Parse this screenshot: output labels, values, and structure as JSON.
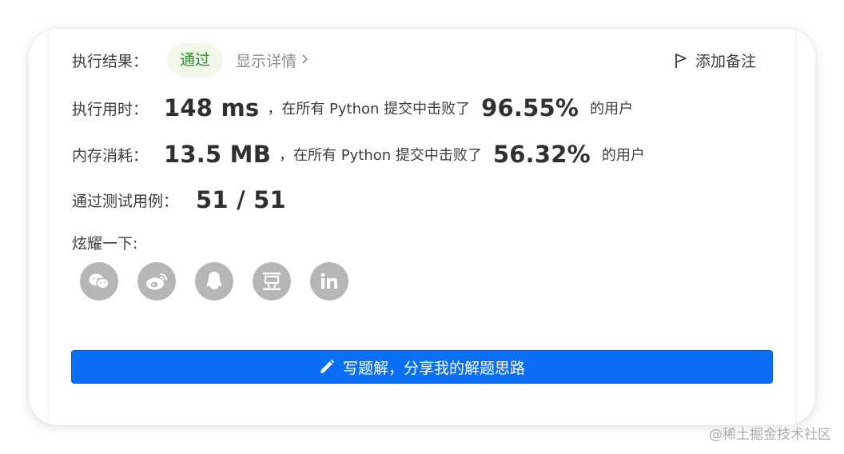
{
  "result": {
    "label": "执行结果：",
    "status": "通过",
    "details_link": "显示详情",
    "add_note": "添加备注"
  },
  "runtime": {
    "label": "执行用时：",
    "value": "148 ms",
    "middle_text": "，在所有 Python 提交中击败了",
    "percent": "96.55%",
    "suffix": "的用户"
  },
  "memory": {
    "label": "内存消耗：",
    "value": "13.5 MB",
    "middle_text": "，在所有 Python 提交中击败了",
    "percent": "56.32%",
    "suffix": "的用户"
  },
  "tests": {
    "label": "通过测试用例：",
    "value": "51 / 51"
  },
  "share": {
    "label": "炫耀一下:",
    "icons": [
      "wechat-icon",
      "weibo-icon",
      "qq-icon",
      "douban-icon",
      "linkedin-icon"
    ]
  },
  "cta": {
    "label": "写题解，分享我的解题思路"
  },
  "watermark": "@稀土掘金技术社区",
  "colors": {
    "pass_green": "#2b8a2b",
    "pass_bg": "#f0f8ea",
    "primary_blue": "#0a6ff5",
    "icon_gray": "#b6b6b6"
  }
}
